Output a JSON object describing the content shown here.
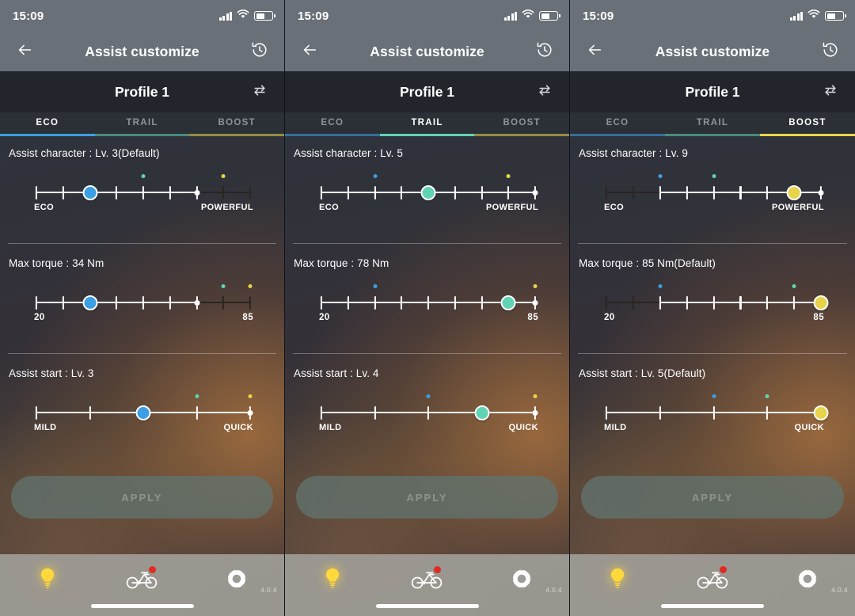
{
  "status_bar": {
    "time": "15:09",
    "signal_icon": "signal-bars-icon",
    "wifi_icon": "wifi-icon",
    "battery_icon": "battery-icon"
  },
  "header": {
    "title": "Assist customize",
    "back_icon": "back-arrow-icon",
    "reset_icon": "history-reset-icon"
  },
  "profile_bar": {
    "title": "Profile 1",
    "swap_icon": "swap-arrows-icon"
  },
  "tabs": [
    {
      "label": "ECO",
      "color": "#3b9fe3"
    },
    {
      "label": "TRAIL",
      "color": "#5fd3b2"
    },
    {
      "label": "BOOST",
      "color": "#e8d44a"
    }
  ],
  "apply": {
    "label": "APPLY",
    "enabled": false
  },
  "bottom_nav": {
    "items": [
      {
        "icon": "light-bulb-icon",
        "badge": false
      },
      {
        "icon": "bicycle-icon",
        "badge": true
      },
      {
        "icon": "gear-icon",
        "badge": false
      }
    ],
    "version": "4.0.4"
  },
  "screens": [
    {
      "active_tab": "ECO",
      "accent": "#3b9fe3",
      "sections": [
        {
          "label": "Assist character : Lv. 3(Default)",
          "min_label": "ECO",
          "max_label": "POWERFUL",
          "steps": 9,
          "value": 3,
          "limit": 7,
          "markers": [
            {
              "level": 5,
              "color": "#5fd3b2"
            },
            {
              "level": 8,
              "color": "#e8d44a"
            }
          ]
        },
        {
          "label": "Max torque : 34 Nm",
          "min_label": "20",
          "max_label": "85",
          "steps": 9,
          "value": 3,
          "limit": 7,
          "markers": [
            {
              "level": 8,
              "color": "#5fd3b2"
            },
            {
              "level": 9,
              "color": "#e8d44a"
            }
          ]
        },
        {
          "label": "Assist start : Lv. 3",
          "min_label": "MILD",
          "max_label": "QUICK",
          "steps": 5,
          "value": 3,
          "limit": 5,
          "markers": [
            {
              "level": 4,
              "color": "#5fd3b2"
            },
            {
              "level": 5,
              "color": "#e8d44a"
            }
          ]
        }
      ]
    },
    {
      "active_tab": "TRAIL",
      "accent": "#5fd3b2",
      "sections": [
        {
          "label": "Assist character : Lv. 5",
          "min_label": "ECO",
          "max_label": "POWERFUL",
          "steps": 9,
          "value": 5,
          "limit": 9,
          "markers": [
            {
              "level": 3,
              "color": "#3b9fe3"
            },
            {
              "level": 8,
              "color": "#e8d44a"
            }
          ]
        },
        {
          "label": "Max torque : 78 Nm",
          "min_label": "20",
          "max_label": "85",
          "steps": 9,
          "value": 8,
          "limit": 9,
          "markers": [
            {
              "level": 3,
              "color": "#3b9fe3"
            },
            {
              "level": 9,
              "color": "#e8d44a"
            }
          ]
        },
        {
          "label": "Assist start : Lv. 4",
          "min_label": "MILD",
          "max_label": "QUICK",
          "steps": 5,
          "value": 4,
          "limit": 5,
          "markers": [
            {
              "level": 3,
              "color": "#3b9fe3"
            },
            {
              "level": 5,
              "color": "#e8d44a"
            }
          ]
        }
      ]
    },
    {
      "active_tab": "BOOST",
      "accent": "#e8d44a",
      "sections": [
        {
          "label": "Assist character : Lv. 9",
          "min_label": "ECO",
          "max_label": "POWERFUL",
          "steps": 9,
          "value": 8,
          "limit": 9,
          "floor": 3,
          "markers": [
            {
              "level": 3,
              "color": "#3b9fe3"
            },
            {
              "level": 5,
              "color": "#5fd3b2"
            }
          ]
        },
        {
          "label": "Max torque : 85 Nm(Default)",
          "min_label": "20",
          "max_label": "85",
          "steps": 9,
          "value": 9,
          "limit": 9,
          "floor": 3,
          "markers": [
            {
              "level": 3,
              "color": "#3b9fe3"
            },
            {
              "level": 8,
              "color": "#5fd3b2"
            }
          ]
        },
        {
          "label": "Assist start : Lv. 5(Default)",
          "min_label": "MILD",
          "max_label": "QUICK",
          "steps": 5,
          "value": 5,
          "limit": 5,
          "markers": [
            {
              "level": 3,
              "color": "#3b9fe3"
            },
            {
              "level": 4,
              "color": "#5fd3b2"
            }
          ]
        }
      ]
    }
  ]
}
